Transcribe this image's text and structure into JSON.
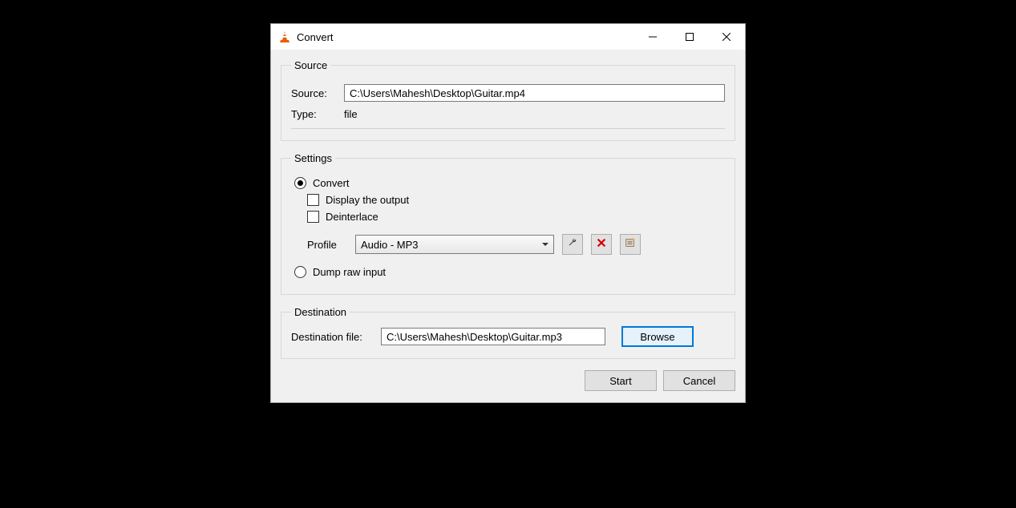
{
  "window": {
    "title": "Convert"
  },
  "source": {
    "legend": "Source",
    "source_label": "Source:",
    "source_value": "C:\\Users\\Mahesh\\Desktop\\Guitar.mp4",
    "type_label": "Type:",
    "type_value": "file"
  },
  "settings": {
    "legend": "Settings",
    "convert_label": "Convert",
    "display_output_label": "Display the output",
    "deinterlace_label": "Deinterlace",
    "profile_label": "Profile",
    "profile_value": "Audio - MP3",
    "dump_label": "Dump raw input"
  },
  "destination": {
    "legend": "Destination",
    "dest_file_label": "Destination file:",
    "dest_file_value": "C:\\Users\\Mahesh\\Desktop\\Guitar.mp3",
    "browse_label": "Browse"
  },
  "footer": {
    "start_label": "Start",
    "cancel_label": "Cancel"
  }
}
